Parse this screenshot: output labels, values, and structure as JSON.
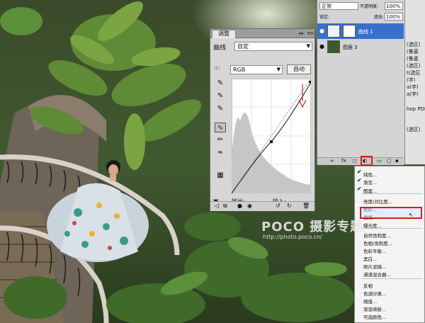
{
  "adjust_panel": {
    "tab": "调整",
    "header_icons": [
      "◂◂",
      "▾≡"
    ],
    "preset_label": "曲线",
    "preset_value": "自定",
    "channel": "RGB",
    "auto_label": "自动",
    "output_label": "输出:",
    "input_label": "输入:"
  },
  "layers_panel": {
    "blend_mode": "正常",
    "opacity_label": "不透明度:",
    "opacity_value": "100%",
    "lock_label": "锁定:",
    "fill_label": "填充:",
    "fill_value": "100%",
    "layers": [
      {
        "name": "曲线 1",
        "selected": true
      },
      {
        "name": "图层 3",
        "selected": false
      }
    ]
  },
  "props_panel": {
    "lines": [
      "(选区)",
      "(鲁菱",
      "(鲁菱",
      "(选区)",
      "t(选区",
      "(字)",
      "a(字)",
      "a(字)",
      "hop PDF",
      "(选区)"
    ]
  },
  "menu": {
    "items": [
      "纯色...",
      "渐变...",
      "图案...",
      "亮度/对比度...",
      "色阶...",
      "曲线...",
      "曝光度...",
      "自然饱和度...",
      "色相/饱和度...",
      "色彩平衡...",
      "黑白...",
      "照片滤镜...",
      "通道混合器...",
      "反相",
      "色调分离...",
      "阈值...",
      "渐变映射...",
      "可选颜色..."
    ],
    "highlighted": "曲线..."
  },
  "watermark": {
    "brand": "POCO 摄影专题",
    "url": "http://photo.poco.cn/"
  },
  "colors": {
    "highlight_red": "#d02020",
    "panel_gray": "#d6d6d6"
  }
}
